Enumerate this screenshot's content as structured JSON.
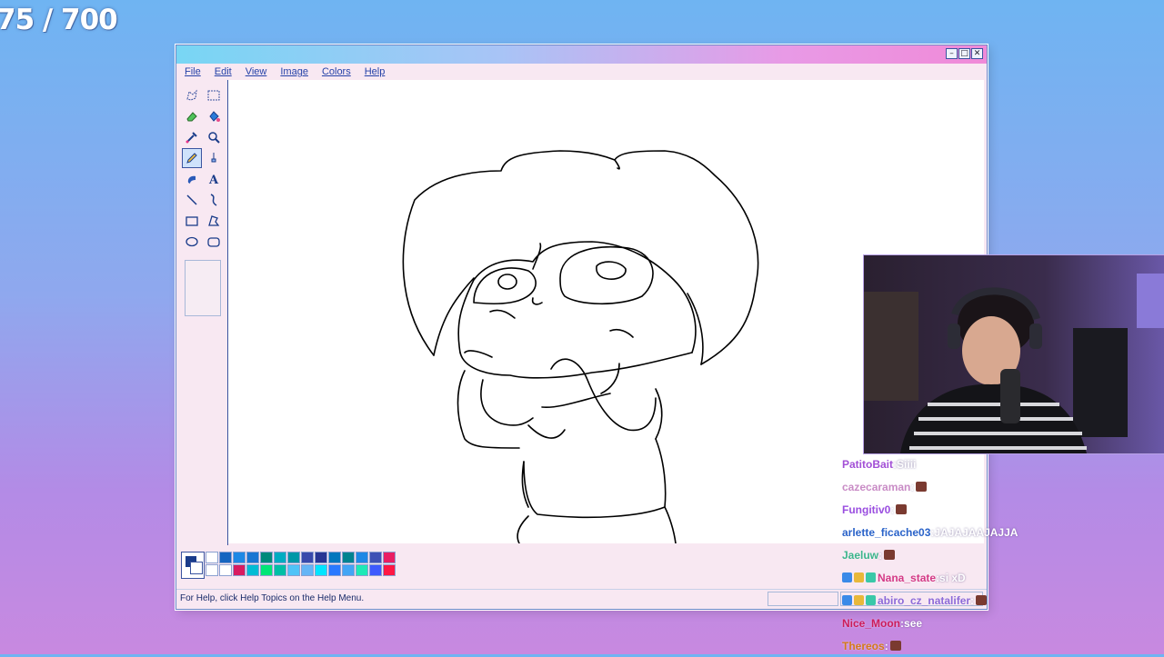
{
  "stream_counter": "75 / 700",
  "window": {
    "title": "",
    "controls": [
      "minimize-icon",
      "maximize-icon",
      "close-icon"
    ],
    "menu": [
      "File",
      "Edit",
      "View",
      "Image",
      "Colors",
      "Help"
    ],
    "tools": [
      {
        "name": "free-form-select-icon"
      },
      {
        "name": "select-icon"
      },
      {
        "name": "eraser-icon"
      },
      {
        "name": "fill-icon"
      },
      {
        "name": "pick-color-icon"
      },
      {
        "name": "magnifier-icon"
      },
      {
        "name": "pencil-icon",
        "active": true
      },
      {
        "name": "brush-icon"
      },
      {
        "name": "airbrush-icon"
      },
      {
        "name": "text-icon",
        "glyph": "A"
      },
      {
        "name": "line-icon"
      },
      {
        "name": "curve-icon"
      },
      {
        "name": "rectangle-icon"
      },
      {
        "name": "polygon-icon"
      },
      {
        "name": "ellipse-icon"
      },
      {
        "name": "rounded-rectangle-icon"
      }
    ],
    "colors": {
      "foreground": "#1a3c8a",
      "background": "#ffffff",
      "palette": [
        "#ffffff",
        "#1565c0",
        "#1e88e5",
        "#1976d2",
        "#00897b",
        "#00acc1",
        "#0097a7",
        "#3949ab",
        "#283593",
        "#0277bd",
        "#00838f",
        "#1e88e5",
        "#3f51b5",
        "#e91e63",
        "#ffffff",
        "#ffffff",
        "#d81b60",
        "#00bcd4",
        "#00e676",
        "#00bfa5",
        "#4fc3f7",
        "#64b5f6",
        "#00e5ff",
        "#2979ff",
        "#42a5f5",
        "#1de9b6",
        "#3d5afe",
        "#ff1744"
      ]
    },
    "status": "For Help, click Help Topics on the Help Menu."
  },
  "chat": [
    {
      "user": "PatitoBait",
      "color": "#a24fd6",
      "message": "Siiii",
      "emote": false
    },
    {
      "user": "cazecaraman",
      "color": "#c98cc6",
      "message": "",
      "emote": true
    },
    {
      "user": "Fungitiv0",
      "color": "#9a4ee0",
      "message": "",
      "emote": true
    },
    {
      "user": "arlette_ficache03",
      "color": "#2a63c9",
      "message": "JAJAJAAJAJJA",
      "emote": false
    },
    {
      "user": "Jaeluw",
      "color": "#3cb58c",
      "message": "",
      "emote": true
    },
    {
      "user": "Nana_state",
      "color": "#d43a86",
      "message": "si xD",
      "emote": false,
      "badges": true
    },
    {
      "user": "abiro_cz_natalifer",
      "color": "#8c6ad8",
      "message": "",
      "emote": true,
      "badges": true
    },
    {
      "user": "Nice_Moon",
      "color": "#cc1c5a",
      "message": "see",
      "emote": false
    },
    {
      "user": "Thereos",
      "color": "#d47a1a",
      "message": "",
      "emote": true
    }
  ]
}
